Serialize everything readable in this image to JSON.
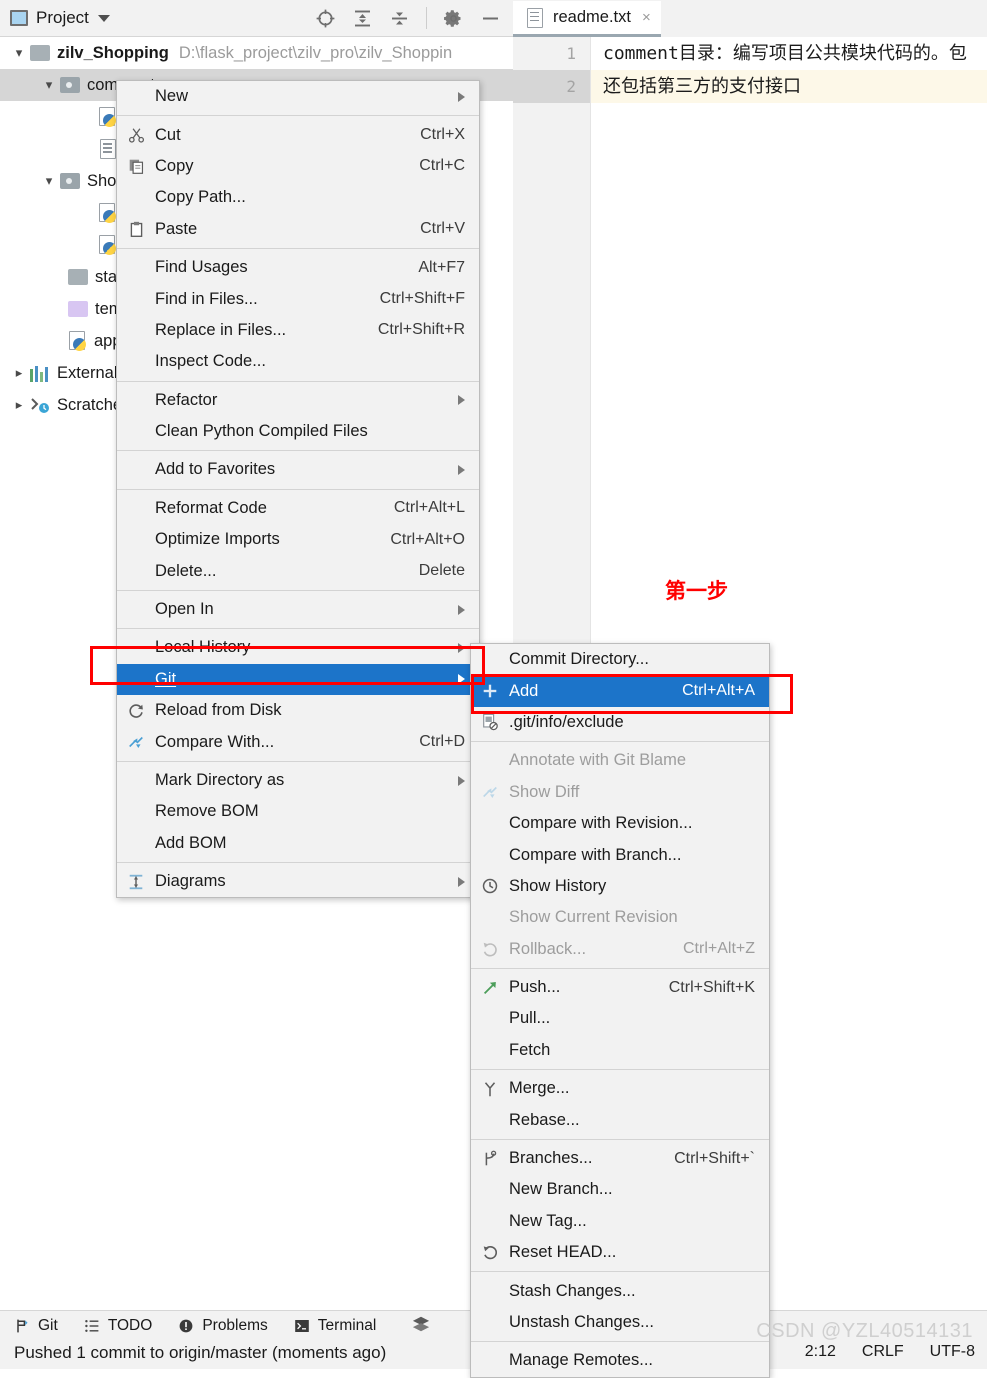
{
  "project_panel": {
    "title": "Project",
    "icons": [
      "select-opened-file-icon",
      "expand-all-icon",
      "collapse-all-icon",
      "settings-gear-icon",
      "hide-icon"
    ],
    "tree": [
      {
        "name": "zilv_Shopping",
        "path": "D:\\flask_project\\zilv_pro\\zilv_Shoppin",
        "icon": "folder-icon",
        "indent": 1,
        "expanded": true,
        "bold": true
      },
      {
        "name": "comment",
        "path": "",
        "icon": "module-folder-icon",
        "indent": 2,
        "expanded": true,
        "selected": true
      },
      {
        "name": "",
        "path": "",
        "icon": "python-file-icon",
        "indent": 4
      },
      {
        "name": "",
        "path": "",
        "icon": "text-file-icon",
        "indent": 4
      },
      {
        "name": "Shop",
        "path": "",
        "icon": "module-folder-icon",
        "indent": 2,
        "expanded": true
      },
      {
        "name": "",
        "path": "",
        "icon": "python-file-icon",
        "indent": 4
      },
      {
        "name": "",
        "path": "",
        "icon": "python-file-icon",
        "indent": 4
      },
      {
        "name": "static",
        "path": "",
        "icon": "folder-icon",
        "indent": 3
      },
      {
        "name": "templates",
        "path": "",
        "icon": "templates-folder-icon",
        "indent": 3
      },
      {
        "name": "app",
        "path": "",
        "icon": "python-file-icon",
        "indent": 3
      },
      {
        "name": "External Libraries",
        "path": "",
        "icon": "libraries-icon",
        "indent": 1,
        "expanded": false
      },
      {
        "name": "Scratches and Consoles",
        "path": "",
        "icon": "scratches-icon",
        "indent": 1,
        "expanded": false
      }
    ]
  },
  "editor": {
    "tab": {
      "label": "readme.txt",
      "icon": "text-file-icon",
      "close": "×"
    },
    "lines": [
      {
        "num": "1",
        "text": "comment目录：编写项目公共模块代码的。包",
        "current": false
      },
      {
        "num": "2",
        "text": "还包括第三方的支付接口",
        "current": true
      }
    ]
  },
  "annotation": {
    "step_one": "第一步",
    "color": "#ff0000"
  },
  "context_menu": {
    "items": [
      {
        "label": "New",
        "accel": "",
        "icon": "",
        "arrow": true,
        "mnemonic": ""
      },
      {
        "sep": true
      },
      {
        "label": "Cut",
        "accel": "Ctrl+X",
        "icon": "scissors-icon",
        "arrow": false,
        "mnemonic": "t"
      },
      {
        "label": "Copy",
        "accel": "Ctrl+C",
        "icon": "copy-icon",
        "arrow": false,
        "mnemonic": "C"
      },
      {
        "label": "Copy Path...",
        "accel": "",
        "icon": "",
        "arrow": false,
        "mnemonic": ""
      },
      {
        "label": "Paste",
        "accel": "Ctrl+V",
        "icon": "clipboard-icon",
        "arrow": false,
        "mnemonic": "P"
      },
      {
        "sep": true
      },
      {
        "label": "Find Usages",
        "accel": "Alt+F7",
        "icon": "",
        "arrow": false,
        "mnemonic": "U"
      },
      {
        "label": "Find in Files...",
        "accel": "Ctrl+Shift+F",
        "icon": "",
        "arrow": false,
        "mnemonic": ""
      },
      {
        "label": "Replace in Files...",
        "accel": "Ctrl+Shift+R",
        "icon": "",
        "arrow": false,
        "mnemonic": "a"
      },
      {
        "label": "Inspect Code...",
        "accel": "",
        "icon": "",
        "arrow": false,
        "mnemonic": "I"
      },
      {
        "sep": true
      },
      {
        "label": "Refactor",
        "accel": "",
        "icon": "",
        "arrow": true,
        "mnemonic": "R"
      },
      {
        "label": "Clean Python Compiled Files",
        "accel": "",
        "icon": "",
        "arrow": false,
        "mnemonic": ""
      },
      {
        "sep": true
      },
      {
        "label": "Add to Favorites",
        "accel": "",
        "icon": "",
        "arrow": true,
        "mnemonic": "a"
      },
      {
        "sep": true
      },
      {
        "label": "Reformat Code",
        "accel": "Ctrl+Alt+L",
        "icon": "",
        "arrow": false,
        "mnemonic": "R"
      },
      {
        "label": "Optimize Imports",
        "accel": "Ctrl+Alt+O",
        "icon": "",
        "arrow": false,
        "mnemonic": "z"
      },
      {
        "label": "Delete...",
        "accel": "Delete",
        "icon": "",
        "arrow": false,
        "mnemonic": "D"
      },
      {
        "sep": true
      },
      {
        "label": "Open In",
        "accel": "",
        "icon": "",
        "arrow": true,
        "mnemonic": ""
      },
      {
        "sep": true
      },
      {
        "label": "Local History",
        "accel": "",
        "icon": "",
        "arrow": true,
        "mnemonic": "H"
      },
      {
        "label": "Git",
        "accel": "",
        "icon": "",
        "arrow": true,
        "selected": true,
        "mnemonic": "G"
      },
      {
        "label": "Reload from Disk",
        "accel": "",
        "icon": "reload-icon",
        "arrow": false,
        "mnemonic": ""
      },
      {
        "label": "Compare With...",
        "accel": "Ctrl+D",
        "icon": "compare-icon",
        "arrow": false,
        "mnemonic": ""
      },
      {
        "sep": true
      },
      {
        "label": "Mark Directory as",
        "accel": "",
        "icon": "",
        "arrow": true,
        "mnemonic": ""
      },
      {
        "label": "Remove BOM",
        "accel": "",
        "icon": "",
        "arrow": false,
        "mnemonic": ""
      },
      {
        "label": "Add BOM",
        "accel": "",
        "icon": "",
        "arrow": false,
        "mnemonic": ""
      },
      {
        "sep": true
      },
      {
        "label": "Diagrams",
        "accel": "",
        "icon": "diagrams-icon",
        "arrow": true,
        "mnemonic": ""
      }
    ]
  },
  "git_submenu": {
    "items": [
      {
        "label": "Commit Directory...",
        "accel": "",
        "icon": "",
        "mnemonic": "it"
      },
      {
        "label": "Add",
        "accel": "Ctrl+Alt+A",
        "icon": "plus-icon",
        "selected": true,
        "mnemonic": ""
      },
      {
        "label": ".git/info/exclude",
        "accel": "",
        "icon": "exclude-file-icon",
        "mnemonic": ""
      },
      {
        "sep": true
      },
      {
        "label": "Annotate with Git Blame",
        "accel": "",
        "icon": "",
        "disabled": true,
        "mnemonic": "n"
      },
      {
        "label": "Show Diff",
        "accel": "",
        "icon": "compare-icon",
        "disabled": true,
        "mnemonic": ""
      },
      {
        "label": "Compare with Revision...",
        "accel": "",
        "icon": "",
        "mnemonic": "C"
      },
      {
        "label": "Compare with Branch...",
        "accel": "",
        "icon": "",
        "mnemonic": ""
      },
      {
        "label": "Show History",
        "accel": "",
        "icon": "clock-icon",
        "mnemonic": "H"
      },
      {
        "label": "Show Current Revision",
        "accel": "",
        "icon": "",
        "disabled": true,
        "mnemonic": ""
      },
      {
        "label": "Rollback...",
        "accel": "Ctrl+Alt+Z",
        "icon": "rollback-icon",
        "disabled": true,
        "mnemonic": "R"
      },
      {
        "sep": true
      },
      {
        "label": "Push...",
        "accel": "Ctrl+Shift+K",
        "icon": "push-arrow-icon",
        "mnemonic": ""
      },
      {
        "label": "Pull...",
        "accel": "",
        "icon": "",
        "mnemonic": ""
      },
      {
        "label": "Fetch",
        "accel": "",
        "icon": "",
        "mnemonic": ""
      },
      {
        "sep": true
      },
      {
        "label": "Merge...",
        "accel": "",
        "icon": "merge-icon",
        "mnemonic": ""
      },
      {
        "label": "Rebase...",
        "accel": "",
        "icon": "",
        "mnemonic": ""
      },
      {
        "sep": true
      },
      {
        "label": "Branches...",
        "accel": "Ctrl+Shift+`",
        "icon": "branch-icon",
        "mnemonic": "B"
      },
      {
        "label": "New Branch...",
        "accel": "",
        "icon": "",
        "mnemonic": ""
      },
      {
        "label": "New Tag...",
        "accel": "",
        "icon": "",
        "mnemonic": ""
      },
      {
        "label": "Reset HEAD...",
        "accel": "",
        "icon": "reset-icon",
        "mnemonic": ""
      },
      {
        "sep": true
      },
      {
        "label": "Stash Changes...",
        "accel": "",
        "icon": "",
        "mnemonic": ""
      },
      {
        "label": "Unstash Changes...",
        "accel": "",
        "icon": "",
        "mnemonic": ""
      },
      {
        "sep": true
      },
      {
        "label": "Manage Remotes...",
        "accel": "",
        "icon": "",
        "mnemonic": ""
      }
    ]
  },
  "statusbar": {
    "tools": [
      {
        "label": "Git",
        "icon": "git-branch-icon"
      },
      {
        "label": "TODO",
        "icon": "todo-list-icon"
      },
      {
        "label": "Problems",
        "icon": "problems-icon"
      },
      {
        "label": "Terminal",
        "icon": "terminal-icon"
      }
    ],
    "layers_icon": "layers-icon",
    "message": "Pushed 1 commit to origin/master (moments ago)",
    "right": [
      "2:12",
      "CRLF",
      "UTF-8"
    ]
  },
  "watermark": "CSDN @YZL40514131",
  "colors": {
    "selection_blue": "#1c74c9",
    "annotation_red": "#ff0000",
    "current_line": "#fdf8e8",
    "panel_bg": "#f2f2f2"
  }
}
